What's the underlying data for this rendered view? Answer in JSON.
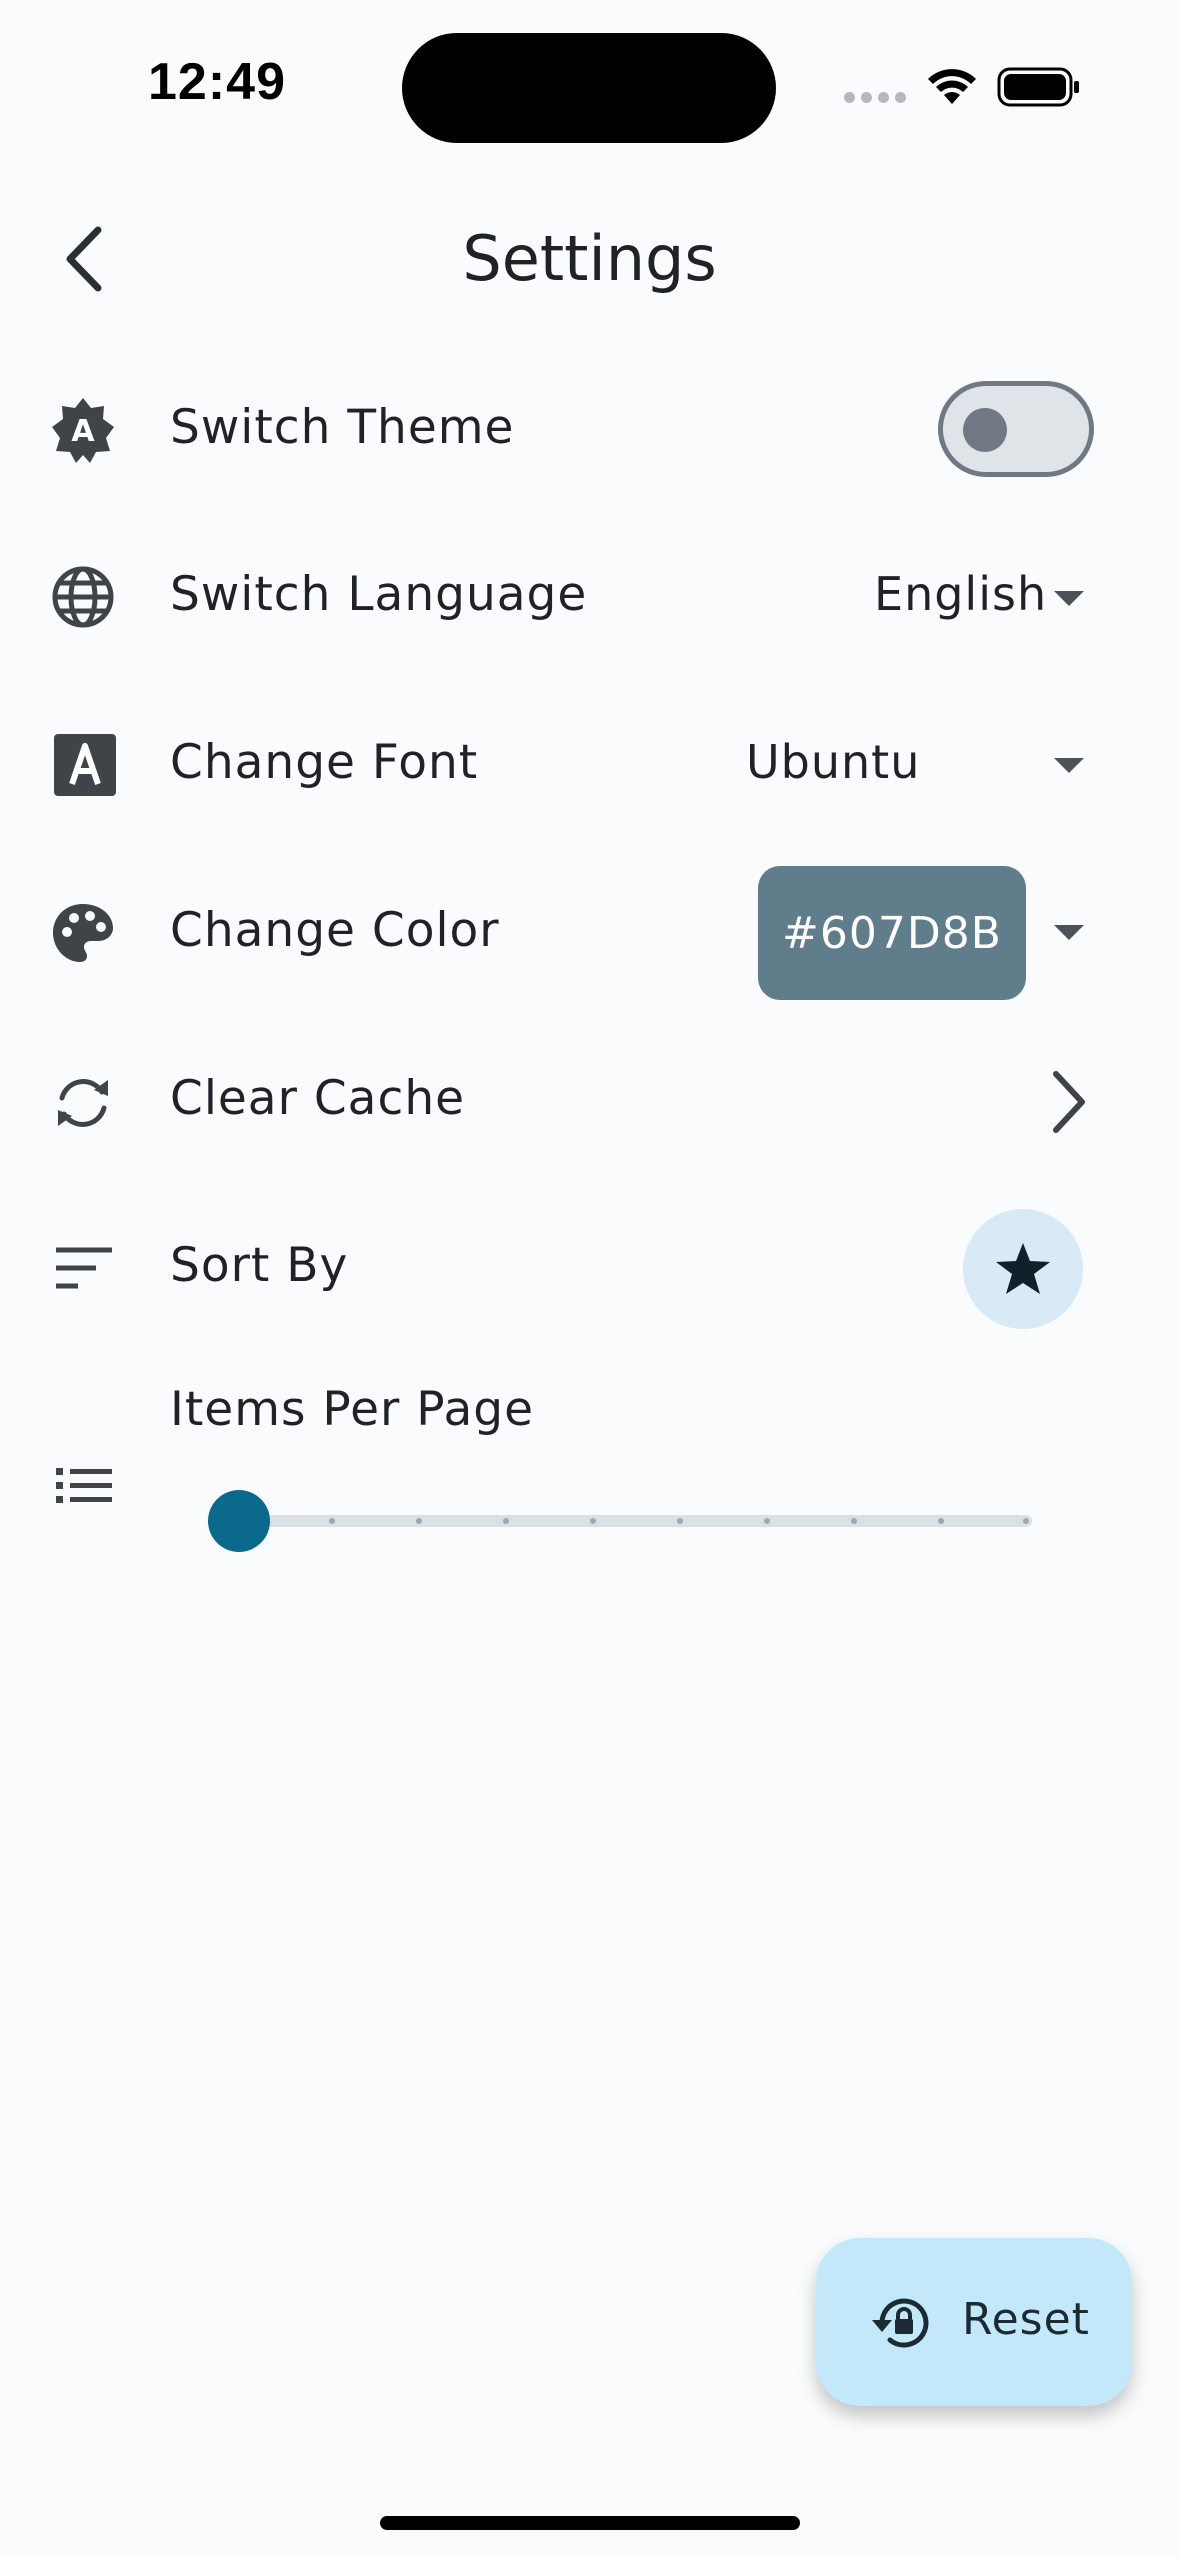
{
  "status_bar": {
    "time": "12:49"
  },
  "header": {
    "title": "Settings",
    "back_icon": "chevron-left-icon"
  },
  "settings": {
    "theme": {
      "label": "Switch Theme",
      "icon": "brightness-auto-icon",
      "toggle_on": false
    },
    "language": {
      "label": "Switch Language",
      "icon": "globe-icon",
      "value": "English"
    },
    "font": {
      "label": "Change Font",
      "icon": "font-icon",
      "value": "Ubuntu"
    },
    "color": {
      "label": "Change Color",
      "icon": "palette-icon",
      "value": "#607D8B",
      "chip_color": "#607D8B"
    },
    "cache": {
      "label": "Clear Cache",
      "icon": "sync-icon"
    },
    "sort": {
      "label": "Sort By",
      "icon": "sort-icon",
      "button_icon": "star-icon"
    },
    "items_per_page": {
      "label": "Items Per Page",
      "icon": "list-icon",
      "slider_value": 0,
      "slider_steps": 9
    }
  },
  "fab": {
    "label": "Reset",
    "icon": "lock-reset-icon"
  },
  "colors": {
    "accent": "#0B6A8B",
    "fab_bg": "#C2E8FA",
    "background": "#F9FBFD"
  }
}
